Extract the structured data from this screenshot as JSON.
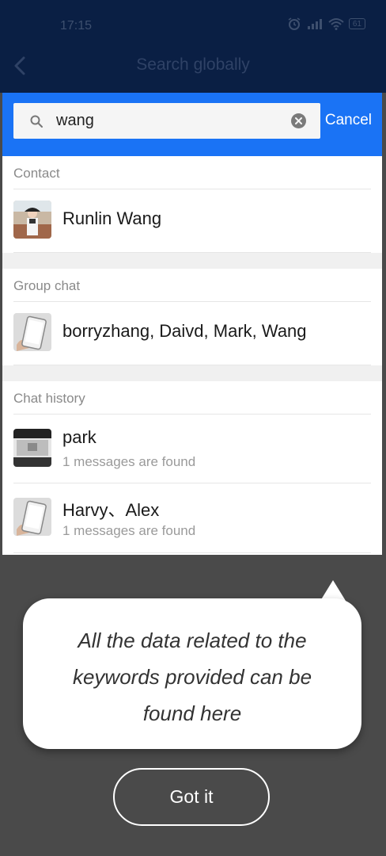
{
  "status_bar": {
    "time": "17:15",
    "battery": "61"
  },
  "header": {
    "title": "Search globally",
    "back_icon": "chevron-left-icon"
  },
  "search": {
    "value": "wang",
    "placeholder": "",
    "cancel_label": "Cancel",
    "search_icon": "search-icon",
    "clear_icon": "clear-icon"
  },
  "sections": {
    "contact": {
      "header": "Contact",
      "items": [
        {
          "title": "Runlin Wang"
        }
      ]
    },
    "group_chat": {
      "header": "Group chat",
      "items": [
        {
          "title": "borryzhang, Daivd, Mark, Wang"
        }
      ]
    },
    "chat_history": {
      "header": "Chat history",
      "items": [
        {
          "title": "park",
          "subtitle": "1 messages are found"
        },
        {
          "title": "Harvy、Alex",
          "subtitle": "1 messages are found"
        }
      ]
    }
  },
  "tooltip": {
    "text": "All the data related to the keywords provided can be found here"
  },
  "got_it_label": "Got it",
  "colors": {
    "accent_blue": "#1a73f5",
    "header_dark": "#0a1f44",
    "overlay": "#4a4a4a"
  }
}
